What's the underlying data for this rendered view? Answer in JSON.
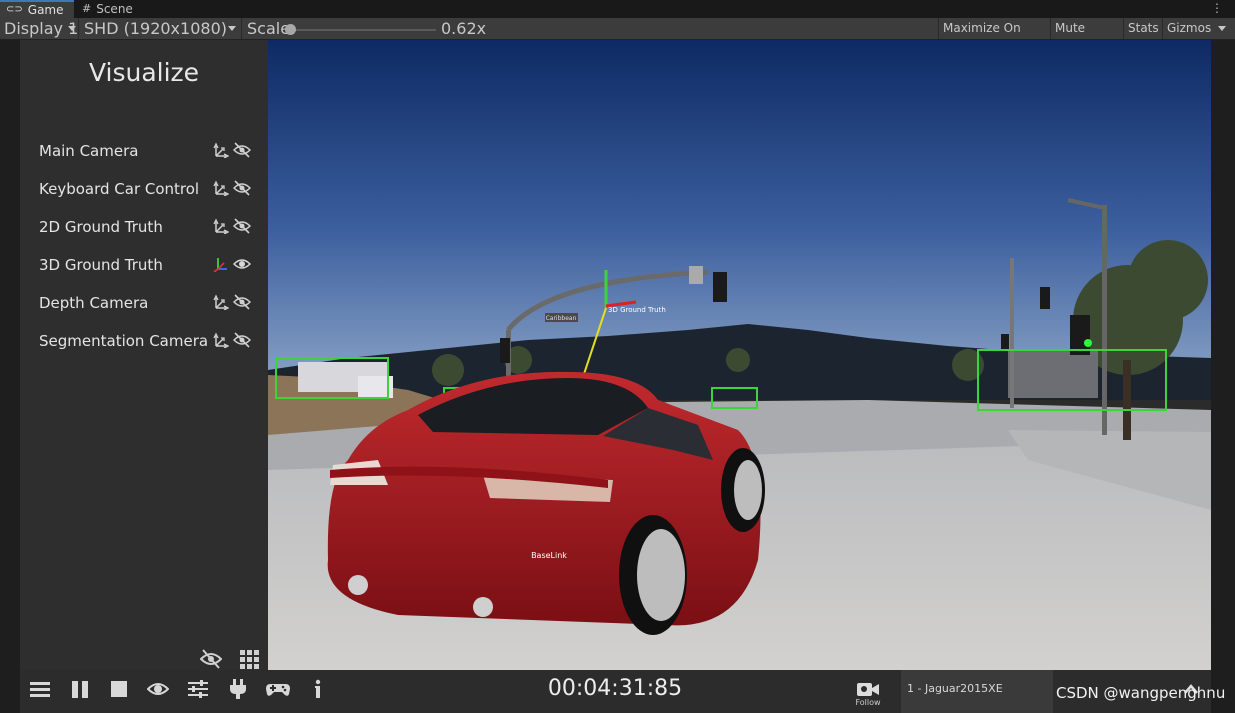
{
  "tabs": {
    "game": "Game",
    "scene": "Scene"
  },
  "toolbar": {
    "display": "Display 1",
    "resolution": "SHD (1920x1080)",
    "scale_label": "Scale",
    "scale_value": "0.62x",
    "scale_fraction": 0.04,
    "maximize": "Maximize On Play",
    "mute": "Mute Audio",
    "stats": "Stats",
    "gizmos": "Gizmos"
  },
  "sidebar": {
    "title": "Visualize",
    "items": [
      {
        "label": "Main Camera",
        "visible": false
      },
      {
        "label": "Keyboard Car Control",
        "visible": false
      },
      {
        "label": "2D Ground Truth",
        "visible": false
      },
      {
        "label": "3D Ground Truth",
        "visible": true
      },
      {
        "label": "Depth Camera",
        "visible": false
      },
      {
        "label": "Segmentation Camera",
        "visible": false
      }
    ]
  },
  "scene": {
    "street_sign": "Caribbean",
    "ground_truth_label": "3D Ground Truth",
    "baselink_label": "BaseLink"
  },
  "bottombar": {
    "timer": "00:04:31:85",
    "follow": "Follow",
    "vehicle": "1 - Jaguar2015XE",
    "icons": [
      "menu-icon",
      "pause-icon",
      "stop-icon",
      "eye-icon",
      "sliders-icon",
      "plug-icon",
      "gamepad-icon",
      "info-icon"
    ]
  },
  "watermark": "CSDN @wangpenghnu",
  "colors": {
    "accent_tab": "#3a79bb",
    "bbox_green": "#3bd43b",
    "car_red": "#a3161e"
  }
}
